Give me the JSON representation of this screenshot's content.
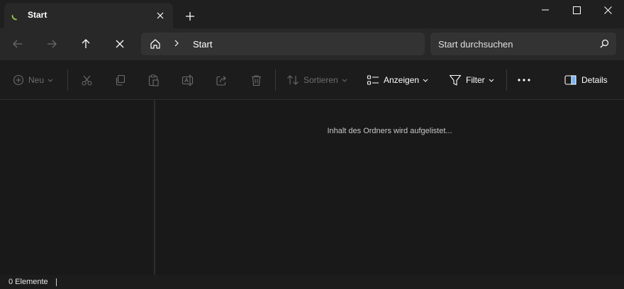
{
  "window": {
    "tab_title": "Start",
    "icons": {
      "tab": "loading-spinner-icon",
      "tab_close": "close-icon",
      "new_tab": "plus-icon",
      "minimize": "minimize-icon",
      "maximize": "maximize-icon",
      "close": "close-icon"
    }
  },
  "navigation": {
    "buttons": [
      "back-arrow-icon",
      "forward-arrow-icon",
      "up-arrow-icon",
      "stop-loading-icon"
    ],
    "breadcrumb": [
      "Start"
    ],
    "search_placeholder": "Start durchsuchen"
  },
  "command_bar": {
    "new_label": "Neu",
    "sort_label": "Sortieren",
    "view_label": "Anzeigen",
    "filter_label": "Filter",
    "details_label": "Details",
    "disabled_icons": [
      "cut-icon",
      "copy-icon",
      "paste-icon",
      "rename-icon",
      "share-icon",
      "delete-icon"
    ]
  },
  "content": {
    "loading_text": "Inhalt des Ordners wird aufgelistet..."
  },
  "status_bar": {
    "item_count": "0 Elemente"
  },
  "colors": {
    "accent": "#9ed04a",
    "background": "#191919",
    "toolbar": "#282828",
    "field": "#333333"
  }
}
